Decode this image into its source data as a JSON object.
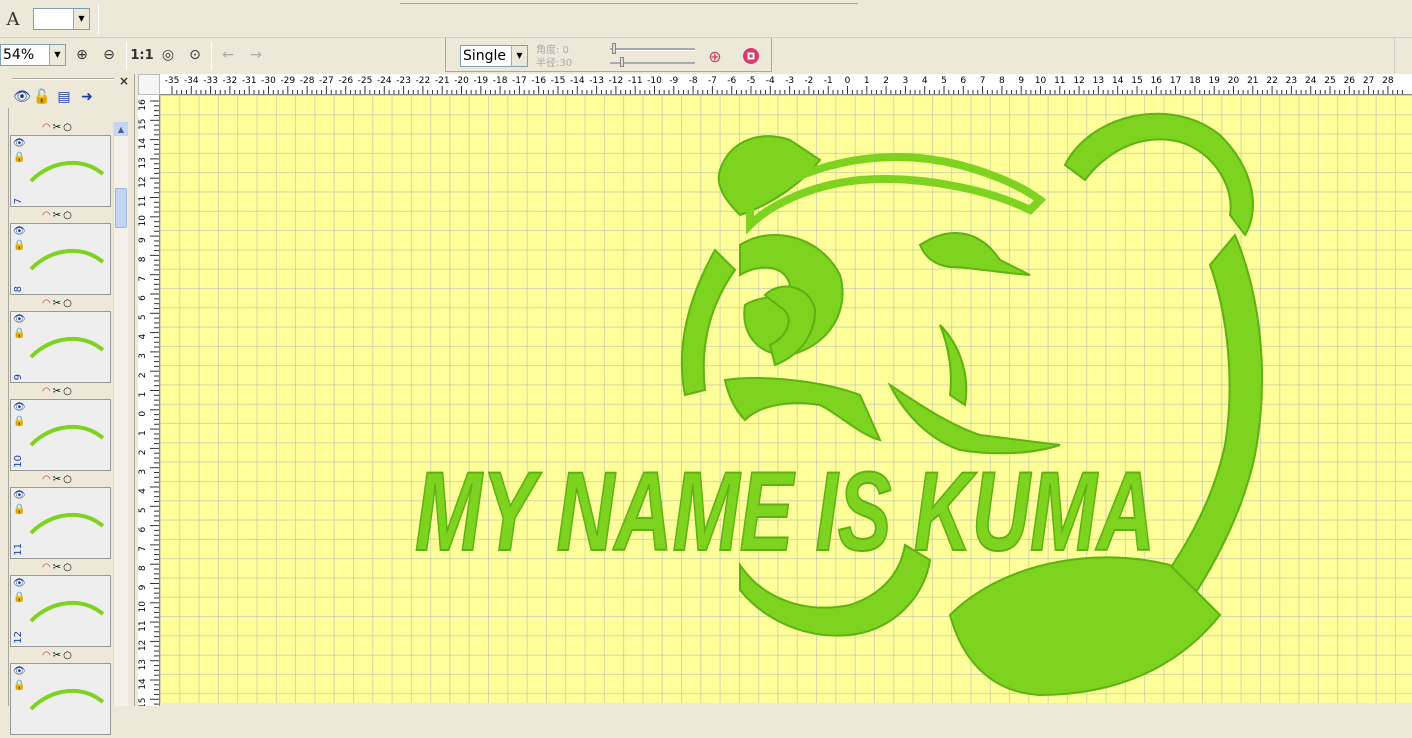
{
  "toolbar": {
    "font_icon": "font-a-icon",
    "font_value": "",
    "zoom_value": "54%",
    "actual_size_label": "1:1",
    "mode_select": "Single",
    "angle_label": "角度: 0",
    "radius_label": "半径:30"
  },
  "panel": {
    "close_label": "×",
    "objects": [
      {
        "number": "7"
      },
      {
        "number": "8"
      },
      {
        "number": "9"
      },
      {
        "number": "10"
      },
      {
        "number": "11"
      },
      {
        "number": "12"
      },
      {
        "number": ""
      }
    ]
  },
  "ruler": {
    "h_labels": [
      "-35",
      "-34",
      "-33",
      "-32",
      "-31",
      "-30",
      "-29",
      "-28",
      "-27",
      "-26",
      "-25",
      "-24",
      "-23",
      "-22",
      "-21",
      "-20",
      "-19",
      "-18",
      "-17",
      "-16",
      "-15",
      "-14",
      "-13",
      "-12",
      "-11",
      "-10",
      "-9",
      "-8",
      "-7",
      "-6",
      "-5",
      "-4",
      "-3",
      "-2",
      "-1",
      "0",
      "1",
      "2",
      "3",
      "4",
      "5",
      "6",
      "7",
      "8",
      "9",
      "10",
      "11",
      "12",
      "13",
      "14",
      "15",
      "16",
      "17",
      "18",
      "19",
      "20",
      "21",
      "22",
      "23",
      "24",
      "25",
      "26",
      "27",
      "28"
    ],
    "v_labels": [
      "16",
      "15",
      "14",
      "13",
      "12",
      "11",
      "10",
      "9",
      "8",
      "7",
      "6",
      "5",
      "4",
      "3",
      "2",
      "1",
      "0",
      "1",
      "2",
      "3",
      "4",
      "5",
      "6",
      "7",
      "8",
      "9",
      "10",
      "11",
      "12",
      "13",
      "14",
      "15"
    ]
  },
  "design": {
    "text": "MY NAME IS KUMA",
    "color": "#7ed321",
    "dark_color": "#5cb20f"
  }
}
